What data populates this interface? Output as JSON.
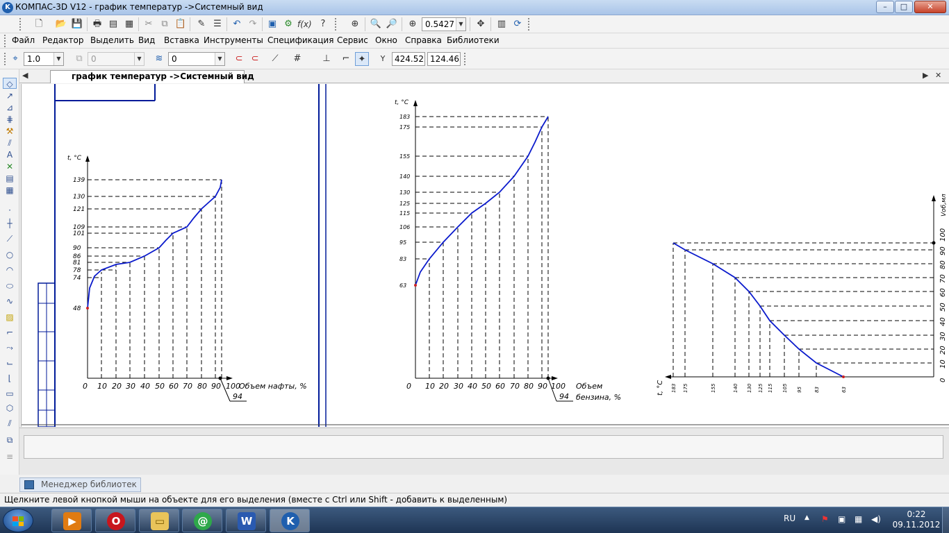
{
  "window": {
    "title": "КОМПАС-3D V12 - график температур ->Системный вид",
    "minimize": "–",
    "maximize": "□",
    "close": "✕"
  },
  "toolbar": {
    "zoom_value": "0.5427",
    "icons": [
      "new-document-icon",
      "open-icon",
      "save-icon",
      "print-icon",
      "preview-icon",
      "cut-icon",
      "copy-icon",
      "paste-icon",
      "brush-icon",
      "list-icon",
      "undo-icon",
      "redo-icon",
      "manager-icon",
      "variables-icon",
      "function-icon",
      "help-pointer-icon",
      "zoom-frame-icon",
      "zoom-in-icon",
      "zoom-out-icon",
      "zoom-scale-icon",
      "pan-icon",
      "redraw-icon",
      "refresh-icon"
    ]
  },
  "menu": {
    "items": [
      "Файл",
      "Редактор",
      "Выделить",
      "Вид",
      "Вставка",
      "Инструменты",
      "Спецификация",
      "Сервис",
      "Окно",
      "Справка",
      "Библиотеки"
    ]
  },
  "current_state": {
    "scale": "1.0",
    "layer": "0",
    "style": "0",
    "coord_x": "424.522",
    "coord_y": "124.465"
  },
  "document": {
    "tab_title": "график температур ->Системный вид",
    "nav_left": "◀",
    "nav_right": "▶",
    "nav_close": "✕"
  },
  "drawing": {
    "chart1": {
      "axis_title_t": "t, °C",
      "y_values": [
        "48",
        "74",
        "78",
        "81",
        "86",
        "90",
        "101",
        "109",
        "121",
        "130",
        "139"
      ],
      "x_values": [
        "0",
        "10",
        "20",
        "30",
        "40",
        "50",
        "60",
        "70",
        "80",
        "90",
        "100"
      ],
      "xlabel": "Объем нафты, %",
      "marker": "94"
    },
    "chart2": {
      "axis_title_t": "t, °C",
      "y_values": [
        "63",
        "83",
        "95",
        "106",
        "115",
        "125",
        "130",
        "140",
        "155",
        "175",
        "183"
      ],
      "x_values": [
        "0",
        "10",
        "20",
        "30",
        "40",
        "50",
        "60",
        "70",
        "80",
        "90",
        "100"
      ],
      "xlabel_line1": "Объем",
      "xlabel_line2": "бензина, %",
      "marker": "94"
    },
    "chart3": {
      "axis_title_t": "t, °C",
      "axis_title_v": "Vоб,мл",
      "t_values": [
        "183",
        "175",
        "155",
        "140",
        "130",
        "125",
        "115",
        "105",
        "95",
        "83",
        "63"
      ],
      "v_values": [
        "0",
        "10",
        "20",
        "30",
        "40",
        "50",
        "60",
        "70",
        "80",
        "90",
        "100"
      ]
    }
  },
  "library_manager": {
    "label": "Менеджер библиотек"
  },
  "status": {
    "text": "Щелкните левой кнопкой мыши на объекте для его выделения (вместе с Ctrl или Shift - добавить к выделенным)"
  },
  "taskbar": {
    "lang": "RU",
    "time": "0:22",
    "date": "09.11.2012",
    "apps": [
      "media-player",
      "opera",
      "file-explorer",
      "mail-agent",
      "word",
      "kompas"
    ]
  },
  "colors": {
    "curve": "#0a1acc",
    "frame": "#001a99",
    "dash": "#000000",
    "point": "#cc2222"
  }
}
